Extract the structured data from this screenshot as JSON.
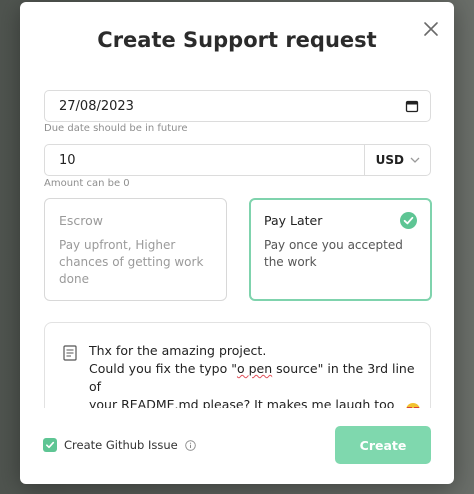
{
  "modal": {
    "title": "Create Support request"
  },
  "date": {
    "value": "27/08/2023",
    "hint": "Due date should be in future"
  },
  "amount": {
    "value": "10",
    "currency": "USD",
    "hint": "Amount can be 0"
  },
  "payment_options": [
    {
      "title": "Escrow",
      "description": "Pay upfront, Higher chances of getting work done",
      "selected": false
    },
    {
      "title": "Pay Later",
      "description": "Pay once you accepted the work",
      "selected": true
    }
  ],
  "message": {
    "line1": "Thx for the amazing project.",
    "line2_pre": "Could you fix the typo \"",
    "line2_typo": "o pen",
    "line2_post": " source\" in the 3rd line of",
    "line3_pre": "your README.md ",
    "line3_typo": "please",
    "line3_post": "? It makes me laugh too hard :)"
  },
  "footer": {
    "checkbox_label": "Create Github Issue",
    "checkbox_checked": true,
    "create_label": "Create"
  },
  "colors": {
    "accent": "#5ec594",
    "button": "#7fd8ae",
    "selected_border": "#7fd3ad"
  },
  "icons": {
    "close": "close-icon",
    "calendar": "calendar-icon",
    "chevron": "chevron-down-icon",
    "check": "check-circle-icon",
    "document": "document-icon",
    "info": "info-icon"
  }
}
